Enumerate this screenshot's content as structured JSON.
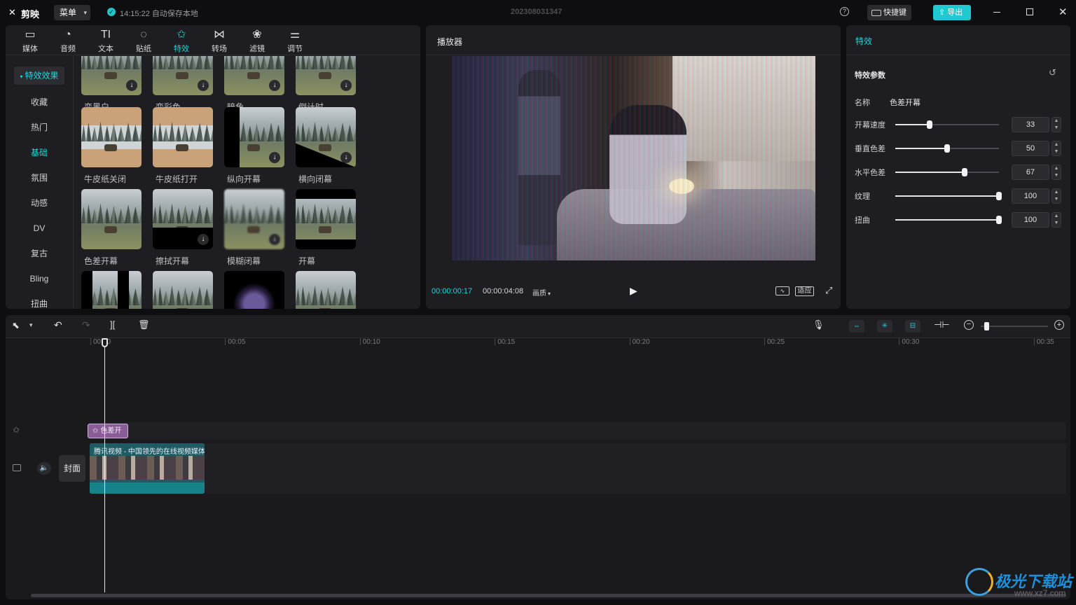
{
  "app": {
    "logo": "剪映",
    "menu_label": "菜单",
    "autosave": "14:15:22 自动保存本地",
    "project_name": "202308031347",
    "shortcut_label": "快捷键",
    "export_label": "导出"
  },
  "toolbar": [
    {
      "id": "media",
      "label": "媒体",
      "icon": "▭"
    },
    {
      "id": "audio",
      "label": "音频",
      "icon": "◔"
    },
    {
      "id": "text",
      "label": "文本",
      "icon": "TI"
    },
    {
      "id": "sticker",
      "label": "贴纸",
      "icon": "◌"
    },
    {
      "id": "effect",
      "label": "特效",
      "icon": "✩",
      "active": true
    },
    {
      "id": "transition",
      "label": "转场",
      "icon": "⋈"
    },
    {
      "id": "filter",
      "label": "滤镜",
      "icon": "❀"
    },
    {
      "id": "adjust",
      "label": "调节",
      "icon": "⚌"
    }
  ],
  "categories": {
    "header": "特效效果",
    "items": [
      "收藏",
      "热门",
      "基础",
      "氛围",
      "动感",
      "DV",
      "复古",
      "Bling",
      "扭曲"
    ],
    "active": "基础"
  },
  "effects": [
    {
      "label": "变黑白",
      "download": true
    },
    {
      "label": "变彩色",
      "download": true
    },
    {
      "label": "暗角",
      "download": true
    },
    {
      "label": "倒计时",
      "download": true
    },
    {
      "label": "牛皮纸关闭",
      "download": false
    },
    {
      "label": "牛皮纸打开",
      "download": false
    },
    {
      "label": "纵向开幕",
      "download": true
    },
    {
      "label": "横向闭幕",
      "download": true
    },
    {
      "label": "色差开幕",
      "download": false
    },
    {
      "label": "擦拭开幕",
      "download": true
    },
    {
      "label": "模糊闭幕",
      "download": true
    },
    {
      "label": "开幕",
      "download": false
    },
    {
      "label": "",
      "download": false
    },
    {
      "label": "",
      "download": false
    },
    {
      "label": "",
      "download": false
    },
    {
      "label": "",
      "download": false
    }
  ],
  "player": {
    "title": "播放器",
    "current_time": "00:00:00:17",
    "total_time": "00:00:04:08",
    "quality_label": "画质",
    "fit_label": "适应"
  },
  "effect_panel": {
    "tab": "特效",
    "section_title": "特效参数",
    "name_label": "名称",
    "name_value": "色差开幕",
    "params": [
      {
        "label": "开幕速度",
        "value": 33,
        "max": 100
      },
      {
        "label": "垂直色差",
        "value": 50,
        "max": 100
      },
      {
        "label": "水平色差",
        "value": 67,
        "max": 100
      },
      {
        "label": "纹理",
        "value": 100,
        "max": 100
      },
      {
        "label": "扭曲",
        "value": 100,
        "max": 100
      }
    ]
  },
  "timeline": {
    "ticks": [
      "00:00",
      "00:05",
      "00:10",
      "00:15",
      "00:20",
      "00:25",
      "00:30",
      "00:35"
    ],
    "effect_clip_label": "色差开",
    "cover_label": "封面",
    "video_clip_title": "腾讯视频 - 中国领先的在线视频媒体",
    "zoom_level": 0.05
  },
  "watermark": {
    "text": "极光下载站",
    "url_text": "www.xz7.com"
  }
}
